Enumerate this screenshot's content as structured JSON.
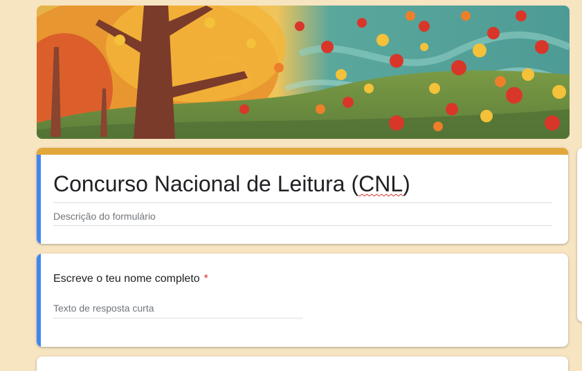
{
  "form": {
    "title_before": "Concurso Nacional de Leitura (",
    "title_spell": "CNL",
    "title_after": ")",
    "description_placeholder": "Descrição do formulário"
  },
  "questions": [
    {
      "title": "Escreve o teu nome completo",
      "required_marker": "*",
      "answer_placeholder": "Texto de resposta curta"
    }
  ],
  "theme": {
    "background": "#f7e4c1",
    "header_strip": "#e1a73b",
    "accent": "#4285f4",
    "required": "#d93025"
  },
  "banner": {
    "description_icon": "autumn-leaves-banner"
  }
}
